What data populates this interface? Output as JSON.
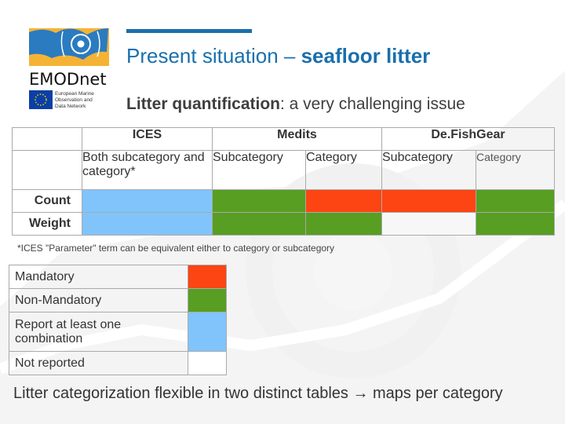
{
  "header": {
    "logo": {
      "name": "EMODnet",
      "tagline_lines": [
        "European Marine",
        "Observation and",
        "Data Network"
      ],
      "colors": {
        "blue": "#2a7bc0",
        "yellow": "#f5b335",
        "eu_blue": "#0b3fa6"
      }
    },
    "title_regular": "Present situation – ",
    "title_bold": "seafloor litter",
    "subtitle_bold": "Litter quantification",
    "subtitle_rest": ": a very challenging issue",
    "accent_color": "#1a6fad"
  },
  "table": {
    "groups": [
      {
        "label": "ICES"
      },
      {
        "label": "Medits"
      },
      {
        "label": "De.FishGear"
      }
    ],
    "subheaders": [
      "Both subcategory and category*",
      "Subcategory",
      "Category",
      "Subcategory",
      "Category"
    ],
    "rows": [
      {
        "label": "Count",
        "cells": [
          "report-one",
          "non-mandatory",
          "mandatory",
          "mandatory",
          "non-mandatory"
        ]
      },
      {
        "label": "Weight",
        "cells": [
          "report-one",
          "non-mandatory",
          "non-mandatory",
          "not-reported",
          "non-mandatory"
        ]
      }
    ]
  },
  "footnote": "*ICES \"Parameter\" term can be equivalent either to category or subcategory",
  "legend": [
    {
      "key": "mandatory",
      "label": "Mandatory",
      "color": "#fc4512"
    },
    {
      "key": "non-mandatory",
      "label": "Non-Mandatory",
      "color": "#579e22"
    },
    {
      "key": "report-one",
      "label": "Report at least one combination",
      "color": "#80c4fb"
    },
    {
      "key": "not-reported",
      "label": "Not reported",
      "color": "#ffffff"
    }
  ],
  "conclusion": {
    "text": "Litter categorization flexible in two distinct tables ",
    "arrow": "→",
    "tail": " maps per category"
  }
}
